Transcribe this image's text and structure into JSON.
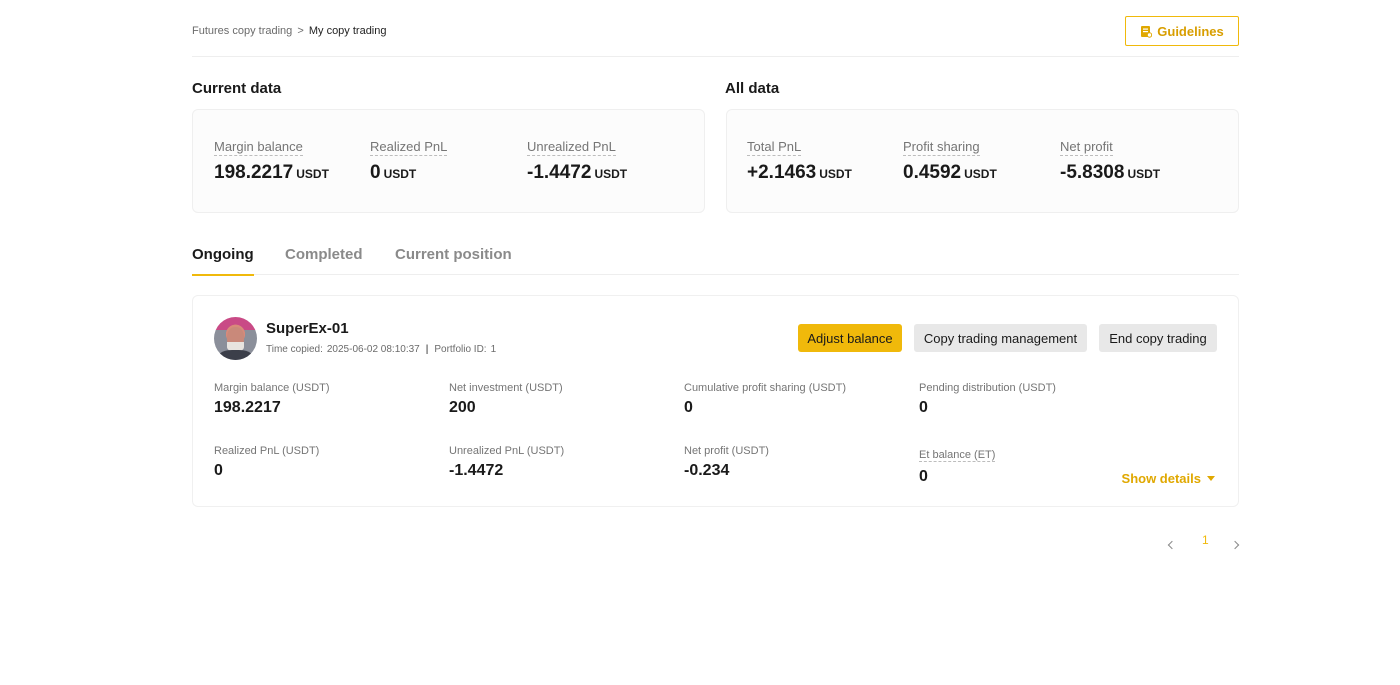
{
  "breadcrumb": {
    "parent": "Futures copy trading",
    "separator": ">",
    "current": "My copy trading"
  },
  "guidelines": {
    "label": "Guidelines",
    "icon": "guide-document-icon"
  },
  "current_data": {
    "title": "Current data",
    "stats": [
      {
        "label": "Margin balance",
        "value": "198.2217",
        "unit": "USDT"
      },
      {
        "label": "Realized PnL",
        "value": "0",
        "unit": "USDT"
      },
      {
        "label": "Unrealized PnL",
        "value": "-1.4472",
        "unit": "USDT"
      }
    ]
  },
  "all_data": {
    "title": "All data",
    "stats": [
      {
        "label": "Total PnL",
        "value": "+2.1463",
        "unit": "USDT"
      },
      {
        "label": "Profit sharing",
        "value": "0.4592",
        "unit": "USDT"
      },
      {
        "label": "Net profit",
        "value": "-5.8308",
        "unit": "USDT"
      }
    ]
  },
  "tabs": [
    {
      "label": "Ongoing",
      "active": true
    },
    {
      "label": "Completed",
      "active": false
    },
    {
      "label": "Current position",
      "active": false
    }
  ],
  "copy_card": {
    "trader_name": "SuperEx-01",
    "time_copied_label": "Time copied:",
    "time_copied_value": "2025-06-02 08:10:37",
    "divider": "|",
    "portfolio_label": "Portfolio ID:",
    "portfolio_value": "1",
    "buttons": {
      "adjust_balance": "Adjust balance",
      "management": "Copy trading management",
      "end": "End copy trading"
    },
    "metrics": [
      {
        "label": "Margin balance (USDT)",
        "value": "198.2217"
      },
      {
        "label": "Net investment (USDT)",
        "value": "200"
      },
      {
        "label": "Cumulative profit sharing (USDT)",
        "value": "0"
      },
      {
        "label": "Pending distribution (USDT)",
        "value": "0"
      },
      {
        "label": "Realized PnL (USDT)",
        "value": "0"
      },
      {
        "label": "Unrealized PnL (USDT)",
        "value": "-1.4472"
      },
      {
        "label": "Net profit (USDT)",
        "value": "-0.234"
      },
      {
        "label": "Et balance (ET)",
        "value": "0"
      }
    ],
    "show_details": "Show details"
  },
  "pagination": {
    "current_page": "1"
  },
  "colors": {
    "accent": "#f0b90b",
    "accent_text": "#d89e00"
  }
}
